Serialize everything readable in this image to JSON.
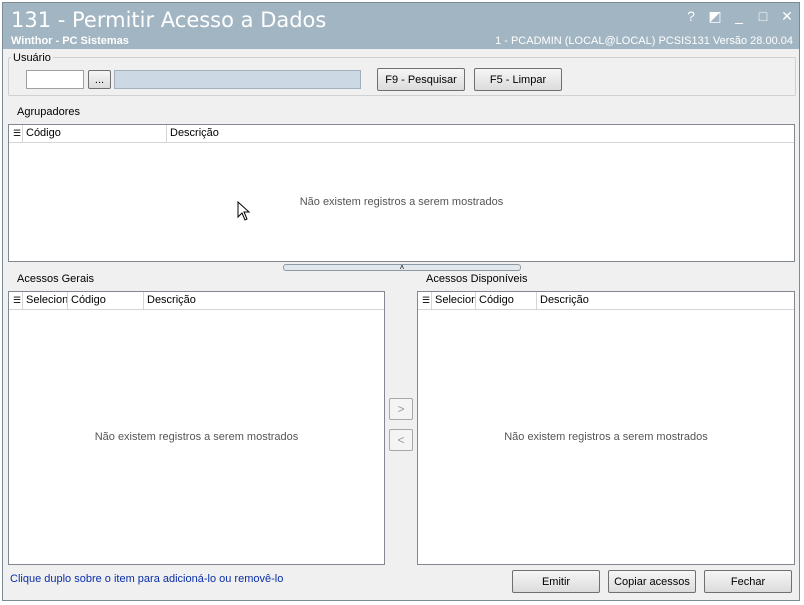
{
  "window": {
    "title": "131 - Permitir Acesso a Dados",
    "subtitle": "Winthor - PC Sistemas",
    "info": "1 - PCADMIN (LOCAL@LOCAL)   PCSIS131  Versão 28.00.04",
    "controls": {
      "help": "?",
      "restore": "◩",
      "minimize": "_",
      "maximize": "□",
      "close": "✕"
    }
  },
  "usuario": {
    "label": "Usuário",
    "code_value": "",
    "browse_label": "...",
    "name_value": "",
    "search_button": "F9 - Pesquisar",
    "clear_button": "F5 - Limpar"
  },
  "agrupadores": {
    "label": "Agrupadores",
    "columns": [
      "Código",
      "Descrição"
    ],
    "empty_text": "Não existem registros a serem mostrados"
  },
  "acessos_gerais": {
    "label": "Acessos Gerais",
    "columns": [
      "Selecionar",
      "Código",
      "Descrição"
    ],
    "empty_text": "Não existem registros a serem mostrados"
  },
  "acessos_disponiveis": {
    "label": "Acessos Disponíveis",
    "columns": [
      "Selecionar",
      "Código",
      "Descrição"
    ],
    "empty_text": "Não existem registros a serem mostrados"
  },
  "transfer": {
    "add_label": ">",
    "remove_label": "<"
  },
  "footer": {
    "hint": "Clique duplo sobre o item para adicioná-lo ou removê-lo",
    "emit_button": "Emitir",
    "copy_button": "Copiar acessos",
    "close_button": "Fechar"
  }
}
